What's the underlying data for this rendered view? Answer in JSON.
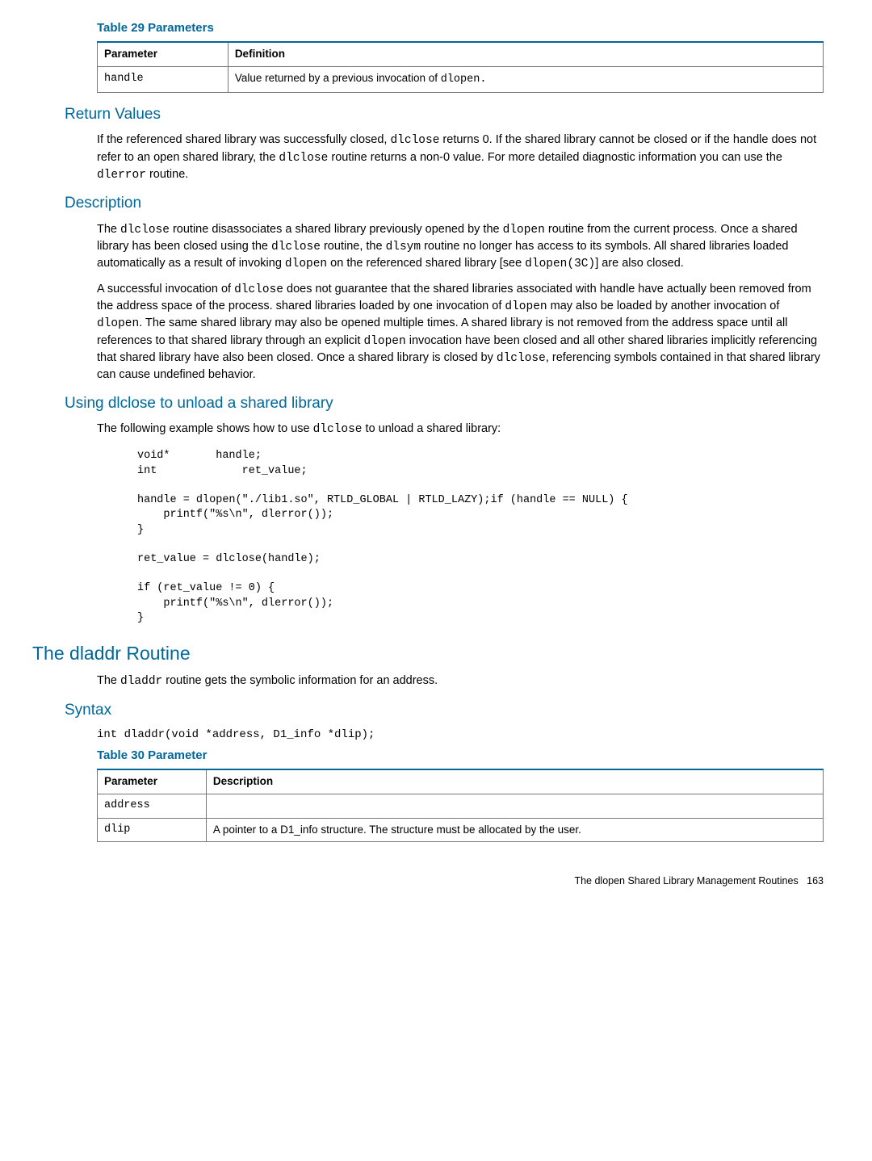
{
  "table29": {
    "caption": "Table 29 Parameters",
    "head_param": "Parameter",
    "head_def": "Definition",
    "row1_param": "handle",
    "row1_def_pre": "Value returned by a previous invocation of ",
    "row1_def_code": "dlopen."
  },
  "return_values": {
    "heading": "Return Values",
    "p1a": "If the referenced shared library was successfully closed, ",
    "p1b": "dlclose",
    "p1c": " returns 0. If the shared library cannot be closed or if the handle does not refer to an open shared library, the ",
    "p1d": "dlclose",
    "p1e": " routine returns a non-0 value. For more detailed diagnostic information you can use the ",
    "p1f": "dlerror",
    "p1g": " routine."
  },
  "description": {
    "heading": "Description",
    "p1a": "The ",
    "p1b": "dlclose",
    "p1c": " routine disassociates a shared library previously opened by the ",
    "p1d": "dlopen",
    "p1e": " routine from the current process. Once a shared library has been closed using the ",
    "p1f": "dlclose",
    "p1g": " routine, the ",
    "p1h": "dlsym",
    "p1i": " routine no longer has access to its symbols. All shared libraries loaded automatically as a result of invoking ",
    "p1j": "dlopen",
    "p1k": " on the referenced shared library [see ",
    "p1l": "dlopen(3C)",
    "p1m": "] are also closed.",
    "p2a": "A successful invocation of ",
    "p2b": "dlclose",
    "p2c": " does not guarantee that the shared libraries associated with handle have actually been removed from the address space of the process. shared libraries loaded by one invocation of ",
    "p2d": "dlopen",
    "p2e": " may also be loaded by another invocation of ",
    "p2f": "dlopen",
    "p2g": ". The same shared library may also be opened multiple times. A shared library is not removed from the address space until all references to that shared library through an explicit ",
    "p2h": "dlopen",
    "p2i": " invocation have been closed and all other shared libraries implicitly referencing that shared library have also been closed. Once a shared library is closed by ",
    "p2j": "dlclose",
    "p2k": ", referencing symbols contained in that shared library can cause undefined behavior."
  },
  "using": {
    "heading": "Using dlclose to unload a shared library",
    "p1a": "The following example shows how to use ",
    "p1b": "dlclose",
    "p1c": " to unload a shared library:",
    "code": "void*       handle;\nint             ret_value;\n\nhandle = dlopen(\"./lib1.so\", RTLD_GLOBAL | RTLD_LAZY);if (handle == NULL) {\n    printf(\"%s\\n\", dlerror());\n}\n\nret_value = dlclose(handle);\n\nif (ret_value != 0) {\n    printf(\"%s\\n\", dlerror());\n}"
  },
  "dladdr": {
    "heading": "The dladdr Routine",
    "p1a": "The ",
    "p1b": "dladdr",
    "p1c": " routine gets the symbolic information for an address."
  },
  "syntax": {
    "heading": "Syntax",
    "code": "int dladdr(void *address, D1_info *dlip);"
  },
  "table30": {
    "caption": "Table 30 Parameter",
    "head_param": "Parameter",
    "head_desc": "Description",
    "row1_param": "address",
    "row1_desc": "",
    "row2_param": "dlip",
    "row2_desc": "A pointer to a D1_info structure. The structure must be allocated by the user."
  },
  "footer": {
    "text": "The dlopen Shared Library Management Routines",
    "page": "163"
  }
}
